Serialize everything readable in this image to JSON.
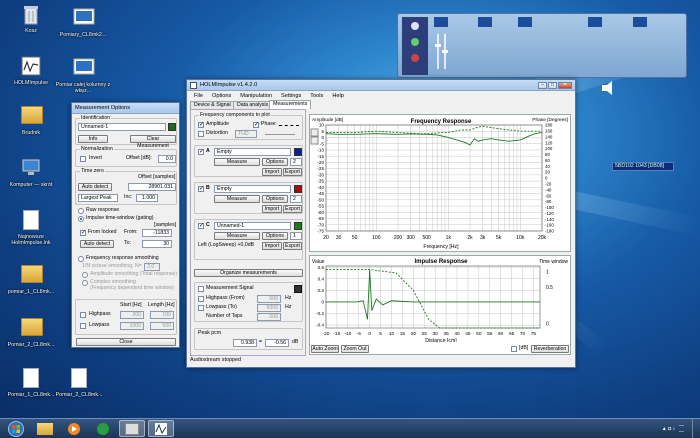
{
  "desktop": {
    "icons": [
      {
        "label": "Kosz"
      },
      {
        "label": "Pomiary_CL8mk2..."
      },
      {
        "label": "HOLMImpulse"
      },
      {
        "label": "Pomiar całej kolumny z wkęz..."
      },
      {
        "label": "Brudnik"
      },
      {
        "label": "Komputer — skrót"
      },
      {
        "label": "Najnowsze HolmImpulse.lnk"
      },
      {
        "label": "pomiar_1_CL8mk..."
      },
      {
        "label": "Pomiar_2_CL8mk..."
      },
      {
        "label": "Pomiar_1_CL8mk..."
      },
      {
        "label": "Pomiar_2_CL8mk..."
      }
    ]
  },
  "gadget": {
    "readout": "5BD102 1043 [DB08]"
  },
  "measurement_options": {
    "title": "Measurement Options",
    "identification": {
      "label": "Identification",
      "value": "Unnamed-1",
      "color": "#1d6b1d",
      "info": "Info",
      "clear": "Clear Measurement"
    },
    "normalization": {
      "label": "Normalization",
      "invert": "Invert",
      "offset_label": "Offset [dB]:",
      "offset": "0.0"
    },
    "time_zero": {
      "label": "Time zero",
      "offset_label": "Offset [samples]",
      "auto_detect": "Auto detect",
      "offset_value": "28901.031",
      "mode": "Largest Peak",
      "inc_label": "Inc:",
      "inc": "1.000"
    },
    "raw_response": "Raw response",
    "impulse_gating": "Impulse time-window (gating)",
    "samples_label": "[samples]",
    "from_locked": "From locked",
    "from_label": "From:",
    "from": "-11833",
    "auto_detect2": "Auto detect",
    "to_label": "To:",
    "to": "30",
    "freq_smoothing": "Frequency response smoothing",
    "octave": "1/N octave smoothing, N=",
    "n": "3.0",
    "amp_smoothing": "Amplitude smoothing (Total response)",
    "complex": "Complex smoothing",
    "complex2": "(Frequency dependent time window)",
    "filters": {
      "start": "Start [Hz]",
      "length": "Length [Hz]",
      "highpass": "Highpass",
      "lowpass": "Lowpass",
      "hp_start": "200",
      "hp_len": "100",
      "lp_start": "1000",
      "lp_len": "500"
    },
    "close": "Close"
  },
  "holm": {
    "title": "HOLMImpulse v1.4.2.0",
    "menu": [
      "File",
      "Options",
      "Manipulation",
      "Settings",
      "Tools",
      "Help"
    ],
    "tabs": [
      "Device & Signal",
      "Data analysis",
      "Measurements"
    ],
    "components": {
      "label": "Frequency components to plot",
      "amplitude": "Amplitude",
      "phase": "Phase",
      "distortion": "Distortion",
      "thd": "THD"
    },
    "channels": [
      {
        "letter": "A",
        "name": "Empty",
        "color": "#0a1f9c",
        "measure": "Measure",
        "options": "Options",
        "num": "2",
        "import": "Import",
        "export": "Export"
      },
      {
        "letter": "B",
        "name": "Empty",
        "color": "#9c1010",
        "measure": "Measure",
        "options": "Options",
        "num": "2",
        "import": "Import",
        "export": "Export"
      },
      {
        "letter": "C",
        "name": "Unnamed-1",
        "color": "#1d7a1d",
        "measure": "Measure",
        "options": "Options",
        "num": "1",
        "import": "Import",
        "export": "Export",
        "status": "Left (LogSweep) +0,0dB"
      }
    ],
    "organize": "Organize measurements",
    "signal": {
      "label": "Measurement Signal",
      "color": "#303030",
      "highpass": "Highpass (From)",
      "hp": "500",
      "lowpass": "Lowpass (To)",
      "lp": "5000",
      "taps": "Number of Taps",
      "taps_v": "500",
      "hz": "Hz"
    },
    "peak": {
      "label": "Peak pcm",
      "v1": "0.938",
      "eq": "=",
      "v2": "-0.56",
      "unit": "dB"
    },
    "status": "Audiostream stopped",
    "freq_panel": {
      "zoom": "Zoom All",
      "reset": "Reset"
    },
    "imp_panel": {
      "value": "Value",
      "window": "Time window",
      "zoom": "Auto Zoom",
      "zoom2": "Zoom Out",
      "db": "[dB]",
      "reverb": "Reverberation"
    }
  },
  "chart_data": [
    {
      "type": "line",
      "title": "Frequency Response",
      "ylabel": "Amplitude [dB]",
      "ylabel2": "Phase [Degrees]",
      "xlabel": "Frequency [Hz]",
      "xticks": [
        "20",
        "30",
        "50",
        "100",
        "200",
        "300",
        "500",
        "1k",
        "2k",
        "3k",
        "5k",
        "10k",
        "20k"
      ],
      "yticks": [
        "10",
        "5",
        "0",
        "-5",
        "-10",
        "-15",
        "-20",
        "-25",
        "-30",
        "-35",
        "-40",
        "-45",
        "-50",
        "-55",
        "-60",
        "-65",
        "-70",
        "-75"
      ],
      "y2ticks": [
        "180",
        "160",
        "140",
        "120",
        "100",
        "80",
        "60",
        "40",
        "20",
        "0",
        "-20",
        "-40",
        "-60",
        "-80",
        "-100",
        "-120",
        "-140",
        "-160",
        "-180"
      ],
      "xlim": [
        20,
        20000
      ],
      "ylim": [
        -75,
        10
      ],
      "series": [
        {
          "x": [
            20,
            30,
            50,
            100,
            200,
            300,
            500,
            700,
            1000,
            1400,
            1700,
            2000,
            2300,
            2600,
            3000,
            4000,
            5000,
            7000,
            10000,
            13000,
            16000,
            20000
          ],
          "y": [
            3,
            2.5,
            2.5,
            3,
            2.5,
            2.8,
            2.5,
            2,
            0,
            -2.5,
            -4,
            -6,
            -1,
            -3,
            -2,
            -1,
            -2,
            -3,
            -2,
            1,
            3,
            4
          ]
        },
        {
          "x": [
            20,
            50,
            100,
            200,
            400,
            600,
            800,
            1000,
            1500,
            2000,
            2500,
            3000,
            5000,
            10000,
            20000
          ],
          "y": [
            4,
            4,
            5,
            4,
            3,
            3,
            4,
            4,
            6,
            6,
            8,
            9,
            7,
            5,
            5
          ]
        }
      ]
    },
    {
      "type": "line",
      "title": "Impulse Response",
      "xlabel": "Distance [cm]",
      "xticks": [
        "-20",
        "-15",
        "-10",
        "-5",
        "0",
        "5",
        "10",
        "15",
        "20",
        "25",
        "30",
        "35",
        "40",
        "45",
        "50",
        "55",
        "60",
        "65",
        "70",
        "75"
      ],
      "yticks": [
        "0.6",
        "0.4",
        "0.2",
        "0",
        "-0.2",
        "-0.4"
      ],
      "y2ticks": [
        "1",
        "0.5",
        "0"
      ],
      "xlim": [
        -20,
        78
      ],
      "ylim": [
        -0.45,
        0.62
      ]
    }
  ]
}
